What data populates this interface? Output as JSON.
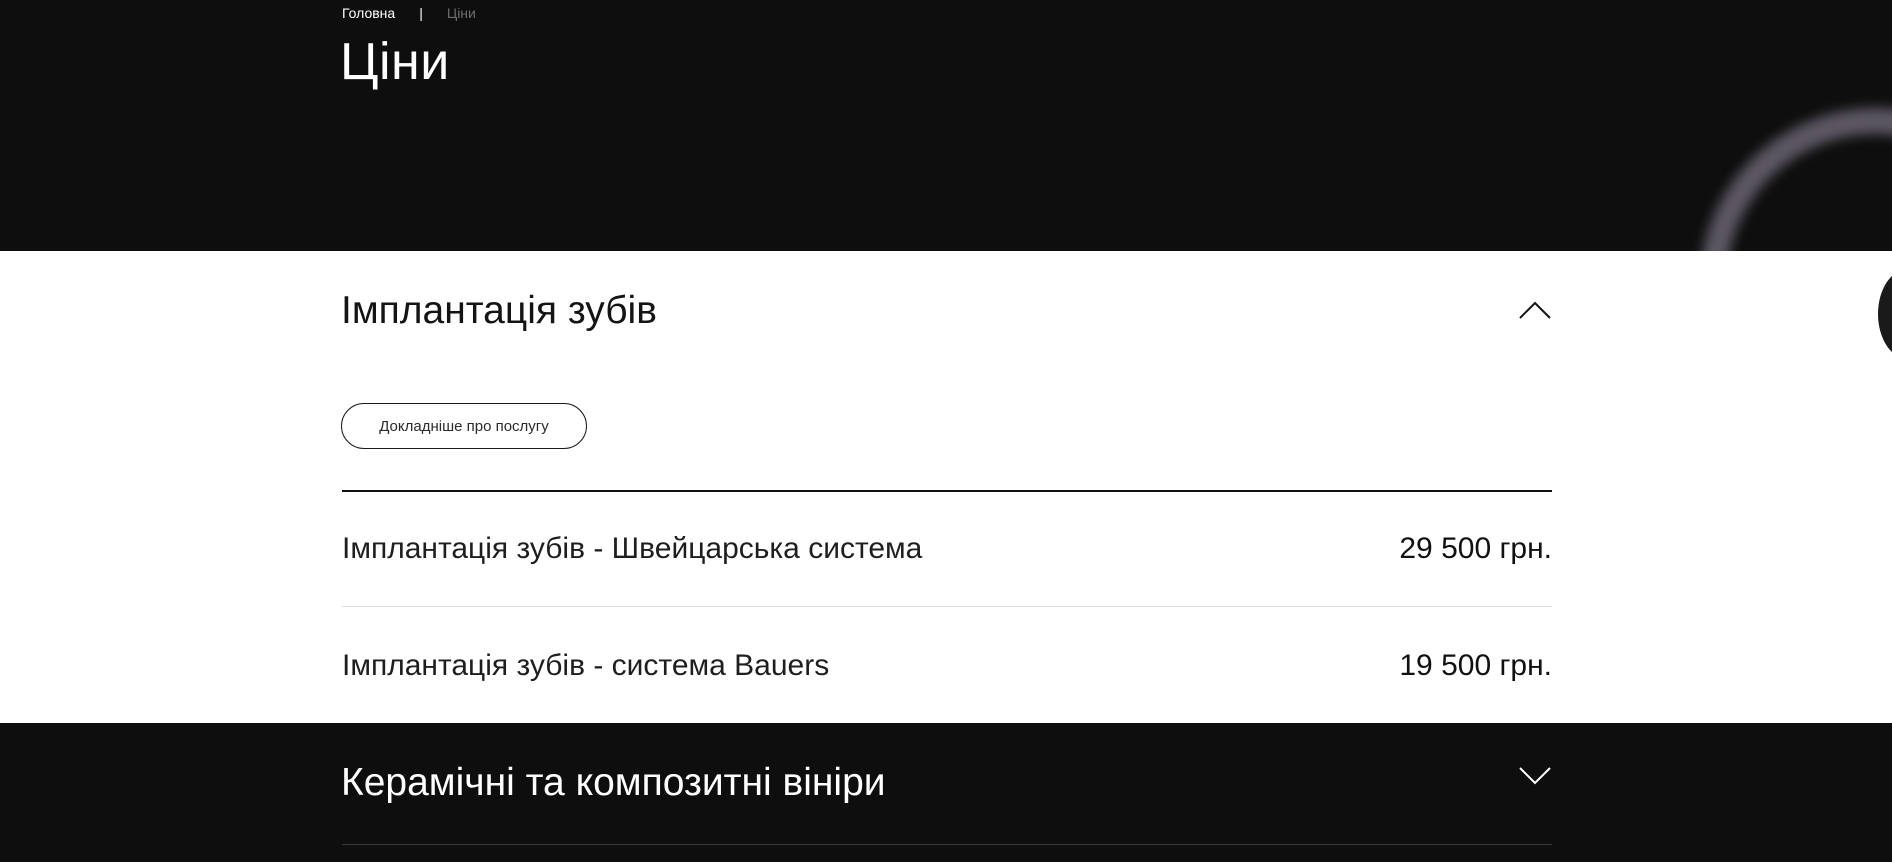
{
  "breadcrumb": {
    "home": "Головна",
    "separator": "|",
    "current": "Ціни"
  },
  "page": {
    "title": "Ціни"
  },
  "sections": [
    {
      "title": "Імплантація зубів",
      "expanded": true,
      "chevron_icon": "chevron-up-icon",
      "more_button": "Докладніше про послугу",
      "items": [
        {
          "name": "Імплантація зубів - Швейцарська система",
          "price": "29 500 грн."
        },
        {
          "name": "Імплантація зубів - система Bauers",
          "price": "19 500 грн."
        }
      ]
    },
    {
      "title": "Керамічні та композитні вініри",
      "expanded": false,
      "chevron_icon": "chevron-down-icon"
    }
  ],
  "colors": {
    "dark_bg": "#0e0e0e",
    "light_bg": "#ffffff",
    "muted_text": "#6c6c6c",
    "decor_ring": "#6a6472"
  }
}
